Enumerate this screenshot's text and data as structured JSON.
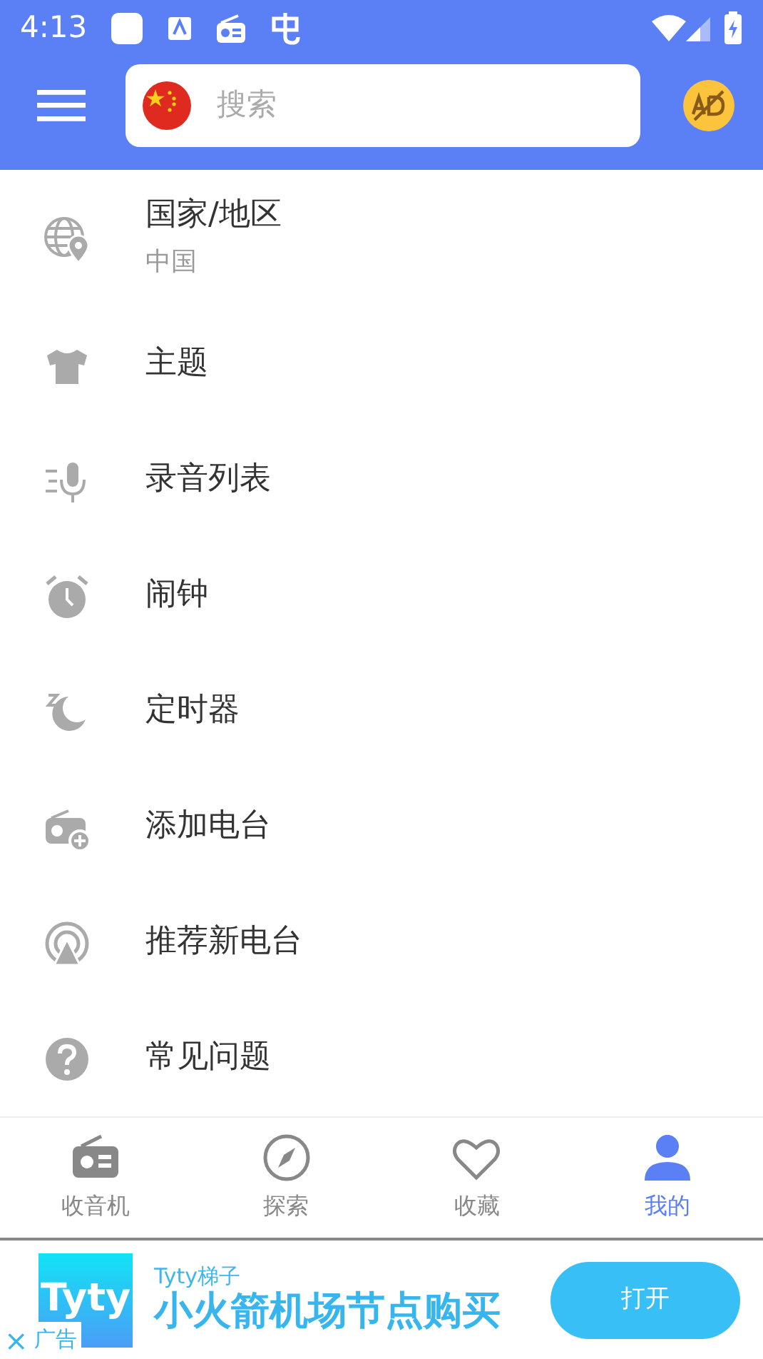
{
  "status_bar": {
    "time": "4:13"
  },
  "toolbar": {
    "search": {
      "placeholder": "搜索"
    }
  },
  "menu": [
    {
      "kind": "globe",
      "label": "国家/地区",
      "value": "中国"
    },
    {
      "kind": "shirt",
      "label": "主题"
    },
    {
      "kind": "mic",
      "label": "录音列表"
    },
    {
      "kind": "alarm",
      "label": "闹钟"
    },
    {
      "kind": "timer",
      "label": "定时器"
    },
    {
      "kind": "radio-add",
      "label": "添加电台"
    },
    {
      "kind": "broadcast",
      "label": "推荐新电台"
    },
    {
      "kind": "help",
      "label": "常见问题"
    }
  ],
  "bottom_nav": [
    {
      "kind": "radio",
      "label": "收音机",
      "selected": false
    },
    {
      "kind": "compass",
      "label": "探索",
      "selected": false
    },
    {
      "kind": "heart",
      "label": "收藏",
      "selected": false
    },
    {
      "kind": "person",
      "label": "我的",
      "selected": true
    }
  ],
  "ad": {
    "logo": "Tyty",
    "brand": "Tyty梯子",
    "headline": "小火箭机场节点购买",
    "button": "打开",
    "close": "×",
    "tag": "广告"
  }
}
